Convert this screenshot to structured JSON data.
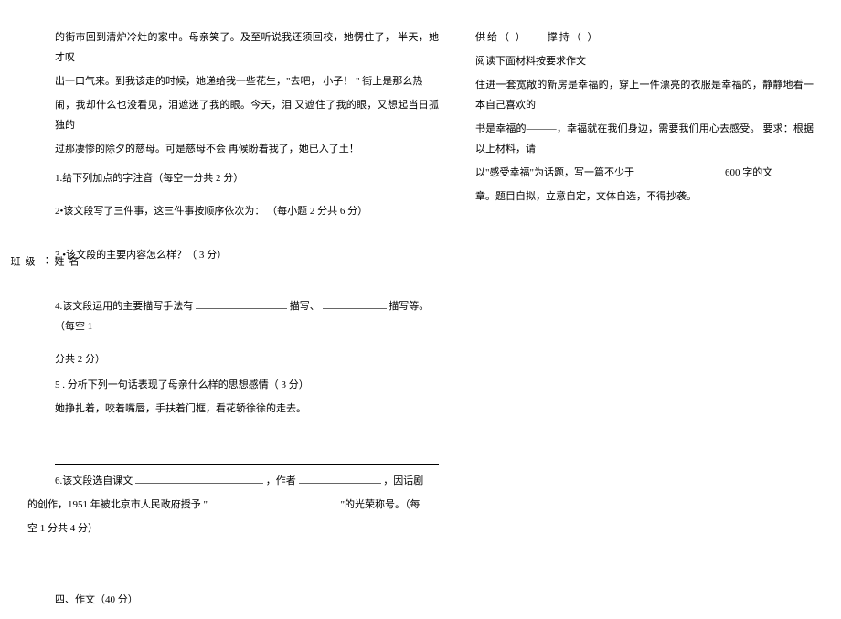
{
  "margin": {
    "name_label": "名",
    "surname_label": "姓",
    "colon": "：",
    "class_label": "级",
    "group_label": "班"
  },
  "left": {
    "passage_line1": "的街市回到清炉冷灶的家中。母亲笑了。及至听说我还须回校，她愣住了，  半天，她才叹",
    "passage_line2": "出一口气来。到我该走的时候，她递给我一些花生，\"去吧，  小子！  \" 街上是那么热",
    "passage_line3": "闹，我却什么也没看见，泪遮迷了我的眼。今天，泪  又遮住了我的眼，又想起当日孤独的",
    "passage_line4": "过那凄惨的除夕的慈母。可是慈母不会 再候盼着我了，她已入了土！",
    "q1": "1.给下列加点的字注音（每空一分共          2 分）",
    "q2": "2•该文段写了三件事，这三件事按顺序依次为：              （每小题 2 分共 6 分）",
    "q3": "3 •该文段的主要内容怎么样？（         3 分）",
    "q4_pre": "4.该文段运用的主要描写手法有  ",
    "q4_mid": "描写、",
    "q4_end": "描写等。（每空 1",
    "q4_line2": "分共 2 分）",
    "q5_line1": "5 . 分析下列一句话表现了母亲什么样的思想感情（            3 分）",
    "q5_line2": "她挣扎着，咬着嘴唇，手扶着门框，看花轿徐徐的走去。",
    "q6_pre": "6.该文段选自课文 ",
    "q6_mid1": "，作者 ",
    "q6_mid2": "，因话剧",
    "q6_line2_pre": "的创作，1951 年被北京市人民政府授予 \"",
    "q6_line2_end": "\"的光荣称号。（每",
    "q6_line3": "空 1 分共 4 分）",
    "section4": "四、作文（40 分）"
  },
  "right": {
    "word1": "供给（           ）",
    "word2": "撑持（           ）",
    "essay_heading": "阅读下面材料按要求作文",
    "essay_line1": "住进一套宽敞的新房是幸福的，穿上一件漂亮的衣服是幸福的，静静地看一 本自己喜欢的",
    "essay_line2": "书是幸福的———，幸福就在我们身边，需要我们用心去感受。  要求：根据以上材料，请",
    "essay_line3_pre": "以\"感受幸福\"为话题，写一篇不少于",
    "essay_line3_num": "600",
    "essay_line3_end": "字的文",
    "essay_line4": "章。题目自拟，立意自定，文体自选，不得抄袭。"
  }
}
